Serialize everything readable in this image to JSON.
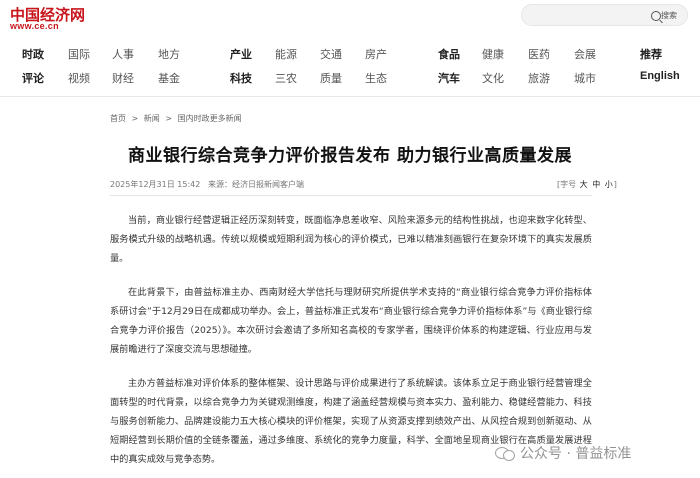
{
  "brand": {
    "name_cn": "中国经济网",
    "url": "www.ce.cn"
  },
  "search": {
    "label": "搜索"
  },
  "nav": {
    "row1": [
      {
        "label": "时政",
        "bold": true
      },
      {
        "label": "国际",
        "bold": false
      },
      {
        "label": "人事",
        "bold": false
      },
      {
        "label": "地方",
        "bold": false
      },
      {
        "label": "产业",
        "bold": true
      },
      {
        "label": "能源",
        "bold": false
      },
      {
        "label": "交通",
        "bold": false
      },
      {
        "label": "房产",
        "bold": false
      },
      {
        "label": "食品",
        "bold": true
      },
      {
        "label": "健康",
        "bold": false
      },
      {
        "label": "医药",
        "bold": false
      },
      {
        "label": "会展",
        "bold": false
      },
      {
        "label": "推荐",
        "bold": true
      }
    ],
    "row2": [
      {
        "label": "评论",
        "bold": true
      },
      {
        "label": "视频",
        "bold": false
      },
      {
        "label": "财经",
        "bold": false
      },
      {
        "label": "基金",
        "bold": false
      },
      {
        "label": "科技",
        "bold": true
      },
      {
        "label": "三农",
        "bold": false
      },
      {
        "label": "质量",
        "bold": false
      },
      {
        "label": "生态",
        "bold": false
      },
      {
        "label": "汽车",
        "bold": true
      },
      {
        "label": "文化",
        "bold": false
      },
      {
        "label": "旅游",
        "bold": false
      },
      {
        "label": "城市",
        "bold": false
      },
      {
        "label": "English",
        "bold": true
      }
    ]
  },
  "breadcrumb": {
    "home": "首页",
    "sep1": ">",
    "news": "新闻",
    "sep2": ">",
    "section": "国内时政更多新闻"
  },
  "article": {
    "title": "商业银行综合竞争力评价报告发布 助力银行业高质量发展",
    "date": "2025年12月31日 15:42",
    "source": "来源：经济日报新闻客户端",
    "font_size": {
      "open": "[字号",
      "large": "大",
      "medium": "中",
      "small": "小",
      "close": "]"
    },
    "paragraphs": [
      "当前，商业银行经营逻辑正经历深刻转变，既面临净息差收窄、风险来源多元的结构性挑战，也迎来数字化转型、服务模式升级的战略机遇。传统以规模或短期利润为核心的评价模式，已难以精准刻画银行在复杂环境下的真实发展质量。",
      "在此背景下，由普益标准主办、西南财经大学信托与理财研究所提供学术支持的“商业银行综合竞争力评价指标体系研讨会”于12月29日在成都成功举办。会上，普益标准正式发布“商业银行综合竞争力评价指标体系”与《商业银行综合竞争力评价报告（2025）》。本次研讨会邀请了多所知名高校的专家学者，围绕评价体系的构建逻辑、行业应用与发展前瞻进行了深度交流与思想碰撞。",
      "主办方普益标准对评价体系的整体框架、设计思路与评价成果进行了系统解读。该体系立足于商业银行经营管理全面转型的时代背景，以综合竞争力为关键观测维度，构建了涵盖经营规模与资本实力、盈利能力、稳健经营能力、科技与服务创新能力、品牌建设能力五大核心模块的评价框架，实现了从资源支撑到绩效产出、从风控合规到创新驱动、从短期经营到长期价值的全链条覆盖，通过多维度、系统化的竞争力度量，科学、全面地呈现商业银行在高质量发展进程中的真实成效与竞争态势。"
    ]
  },
  "watermark": {
    "text": "公众号 · 普益标准"
  }
}
